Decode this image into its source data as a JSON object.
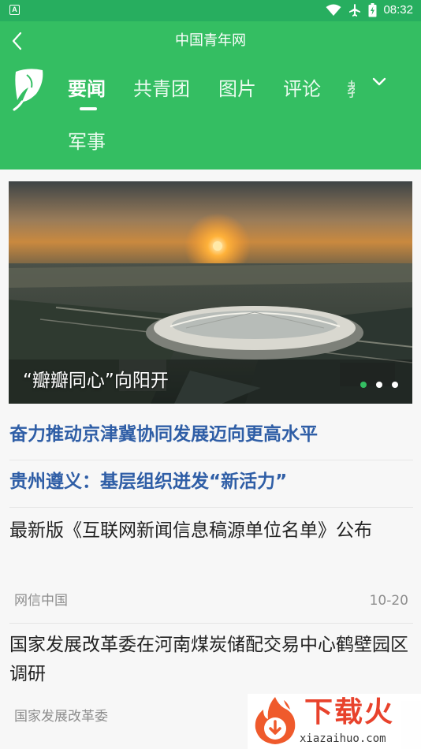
{
  "status_bar": {
    "notification_letter": "A",
    "time": "08:32"
  },
  "app_bar": {
    "title": "中国青年网"
  },
  "tabs": [
    {
      "label": "要闻",
      "active": true
    },
    {
      "label": "共青团",
      "active": false
    },
    {
      "label": "图片",
      "active": false
    },
    {
      "label": "评论",
      "active": false
    },
    {
      "label": "军事",
      "active": false
    }
  ],
  "tab_partial_label": "教",
  "banner": {
    "caption": "“瓣瓣同心”向阳开",
    "slide_count": 3,
    "active_slide": 1
  },
  "headlines": [
    "奋力推动京津冀协同发展迈向更高水平",
    "贵州遵义：基层组织迸发“新活力”"
  ],
  "articles": [
    {
      "title": "最新版《互联网新闻信息稿源单位名单》公布",
      "source": "网信中国",
      "date": "10-20"
    },
    {
      "title": "国家发展改革委在河南煤炭储配交易中心鹤壁园区调研",
      "source": "国家发展改革委",
      "date": ""
    }
  ],
  "watermark": {
    "text": "下载火",
    "url_text": "xiazaihuo.com"
  },
  "colors": {
    "status_bar": "#27ae5f",
    "app_bar": "#34be62",
    "headline": "#2f5ea6",
    "watermark": "#e8422c"
  }
}
